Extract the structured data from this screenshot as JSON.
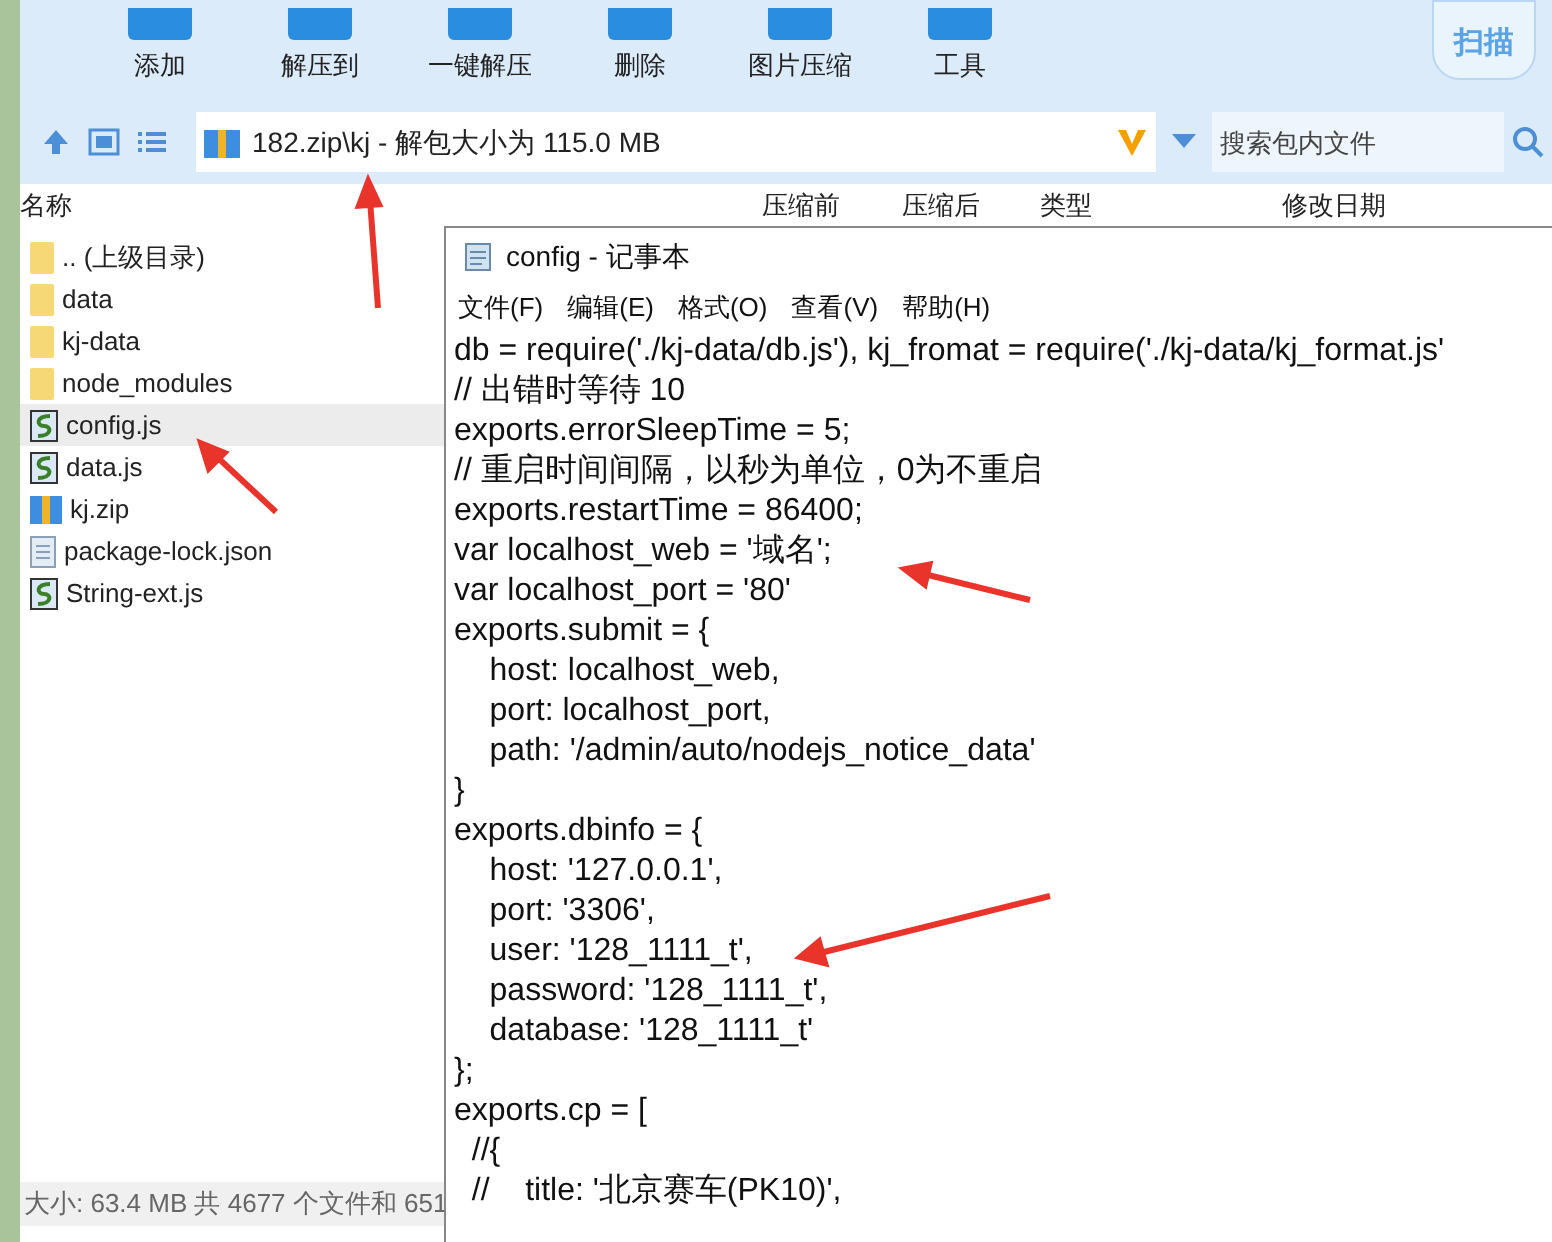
{
  "toolbar": {
    "buttons": [
      {
        "label": "添加"
      },
      {
        "label": "解压到"
      },
      {
        "label": "一键解压"
      },
      {
        "label": "删除"
      },
      {
        "label": "图片压缩"
      },
      {
        "label": "工具"
      }
    ],
    "scan_badge": "扫描"
  },
  "address_bar": {
    "path": "182.zip\\kj - 解包大小为 115.0 MB",
    "search_placeholder": "搜索包内文件"
  },
  "file_list": {
    "columns": [
      "名称",
      "压缩前",
      "压缩后",
      "类型",
      "修改日期"
    ],
    "rows": [
      {
        "name": ".. (上级目录)",
        "kind": "folder",
        "selected": false
      },
      {
        "name": "data",
        "kind": "folder",
        "selected": false
      },
      {
        "name": "kj-data",
        "kind": "folder",
        "selected": false
      },
      {
        "name": "node_modules",
        "kind": "folder",
        "selected": false
      },
      {
        "name": "config.js",
        "kind": "script",
        "selected": true
      },
      {
        "name": "data.js",
        "kind": "script",
        "selected": false
      },
      {
        "name": "kj.zip",
        "kind": "archive",
        "selected": false
      },
      {
        "name": "package-lock.json",
        "kind": "document",
        "selected": false
      },
      {
        "name": "String-ext.js",
        "kind": "script",
        "selected": false
      }
    ]
  },
  "status_bar": "大小: 63.4 MB 共 4677 个文件和 651",
  "notepad": {
    "title": "config - 记事本",
    "menu": [
      "文件(F)",
      "编辑(E)",
      "格式(O)",
      "查看(V)",
      "帮助(H)"
    ],
    "lines": [
      "db = require('./kj-data/db.js'), kj_fromat = require('./kj-data/kj_format.js'",
      "// 出错时等待 10",
      "exports.errorSleepTime = 5;",
      "// 重启时间间隔，以秒为单位，0为不重启",
      "exports.restartTime = 86400;",
      "var localhost_web = '域名';",
      "var localhost_port = '80'",
      "exports.submit = {",
      "    host: localhost_web,",
      "    port: localhost_port,",
      "    path: '/admin/auto/nodejs_notice_data'",
      "}",
      "exports.dbinfo = {",
      "    host: '127.0.0.1',",
      "    port: '3306',",
      "    user: '128_1111_t',",
      "    password: '128_1111_t',",
      "    database: '128_1111_t'",
      "};",
      "exports.cp = [",
      "  //{",
      "  //    title: '北京赛车(PK10)',"
    ]
  }
}
